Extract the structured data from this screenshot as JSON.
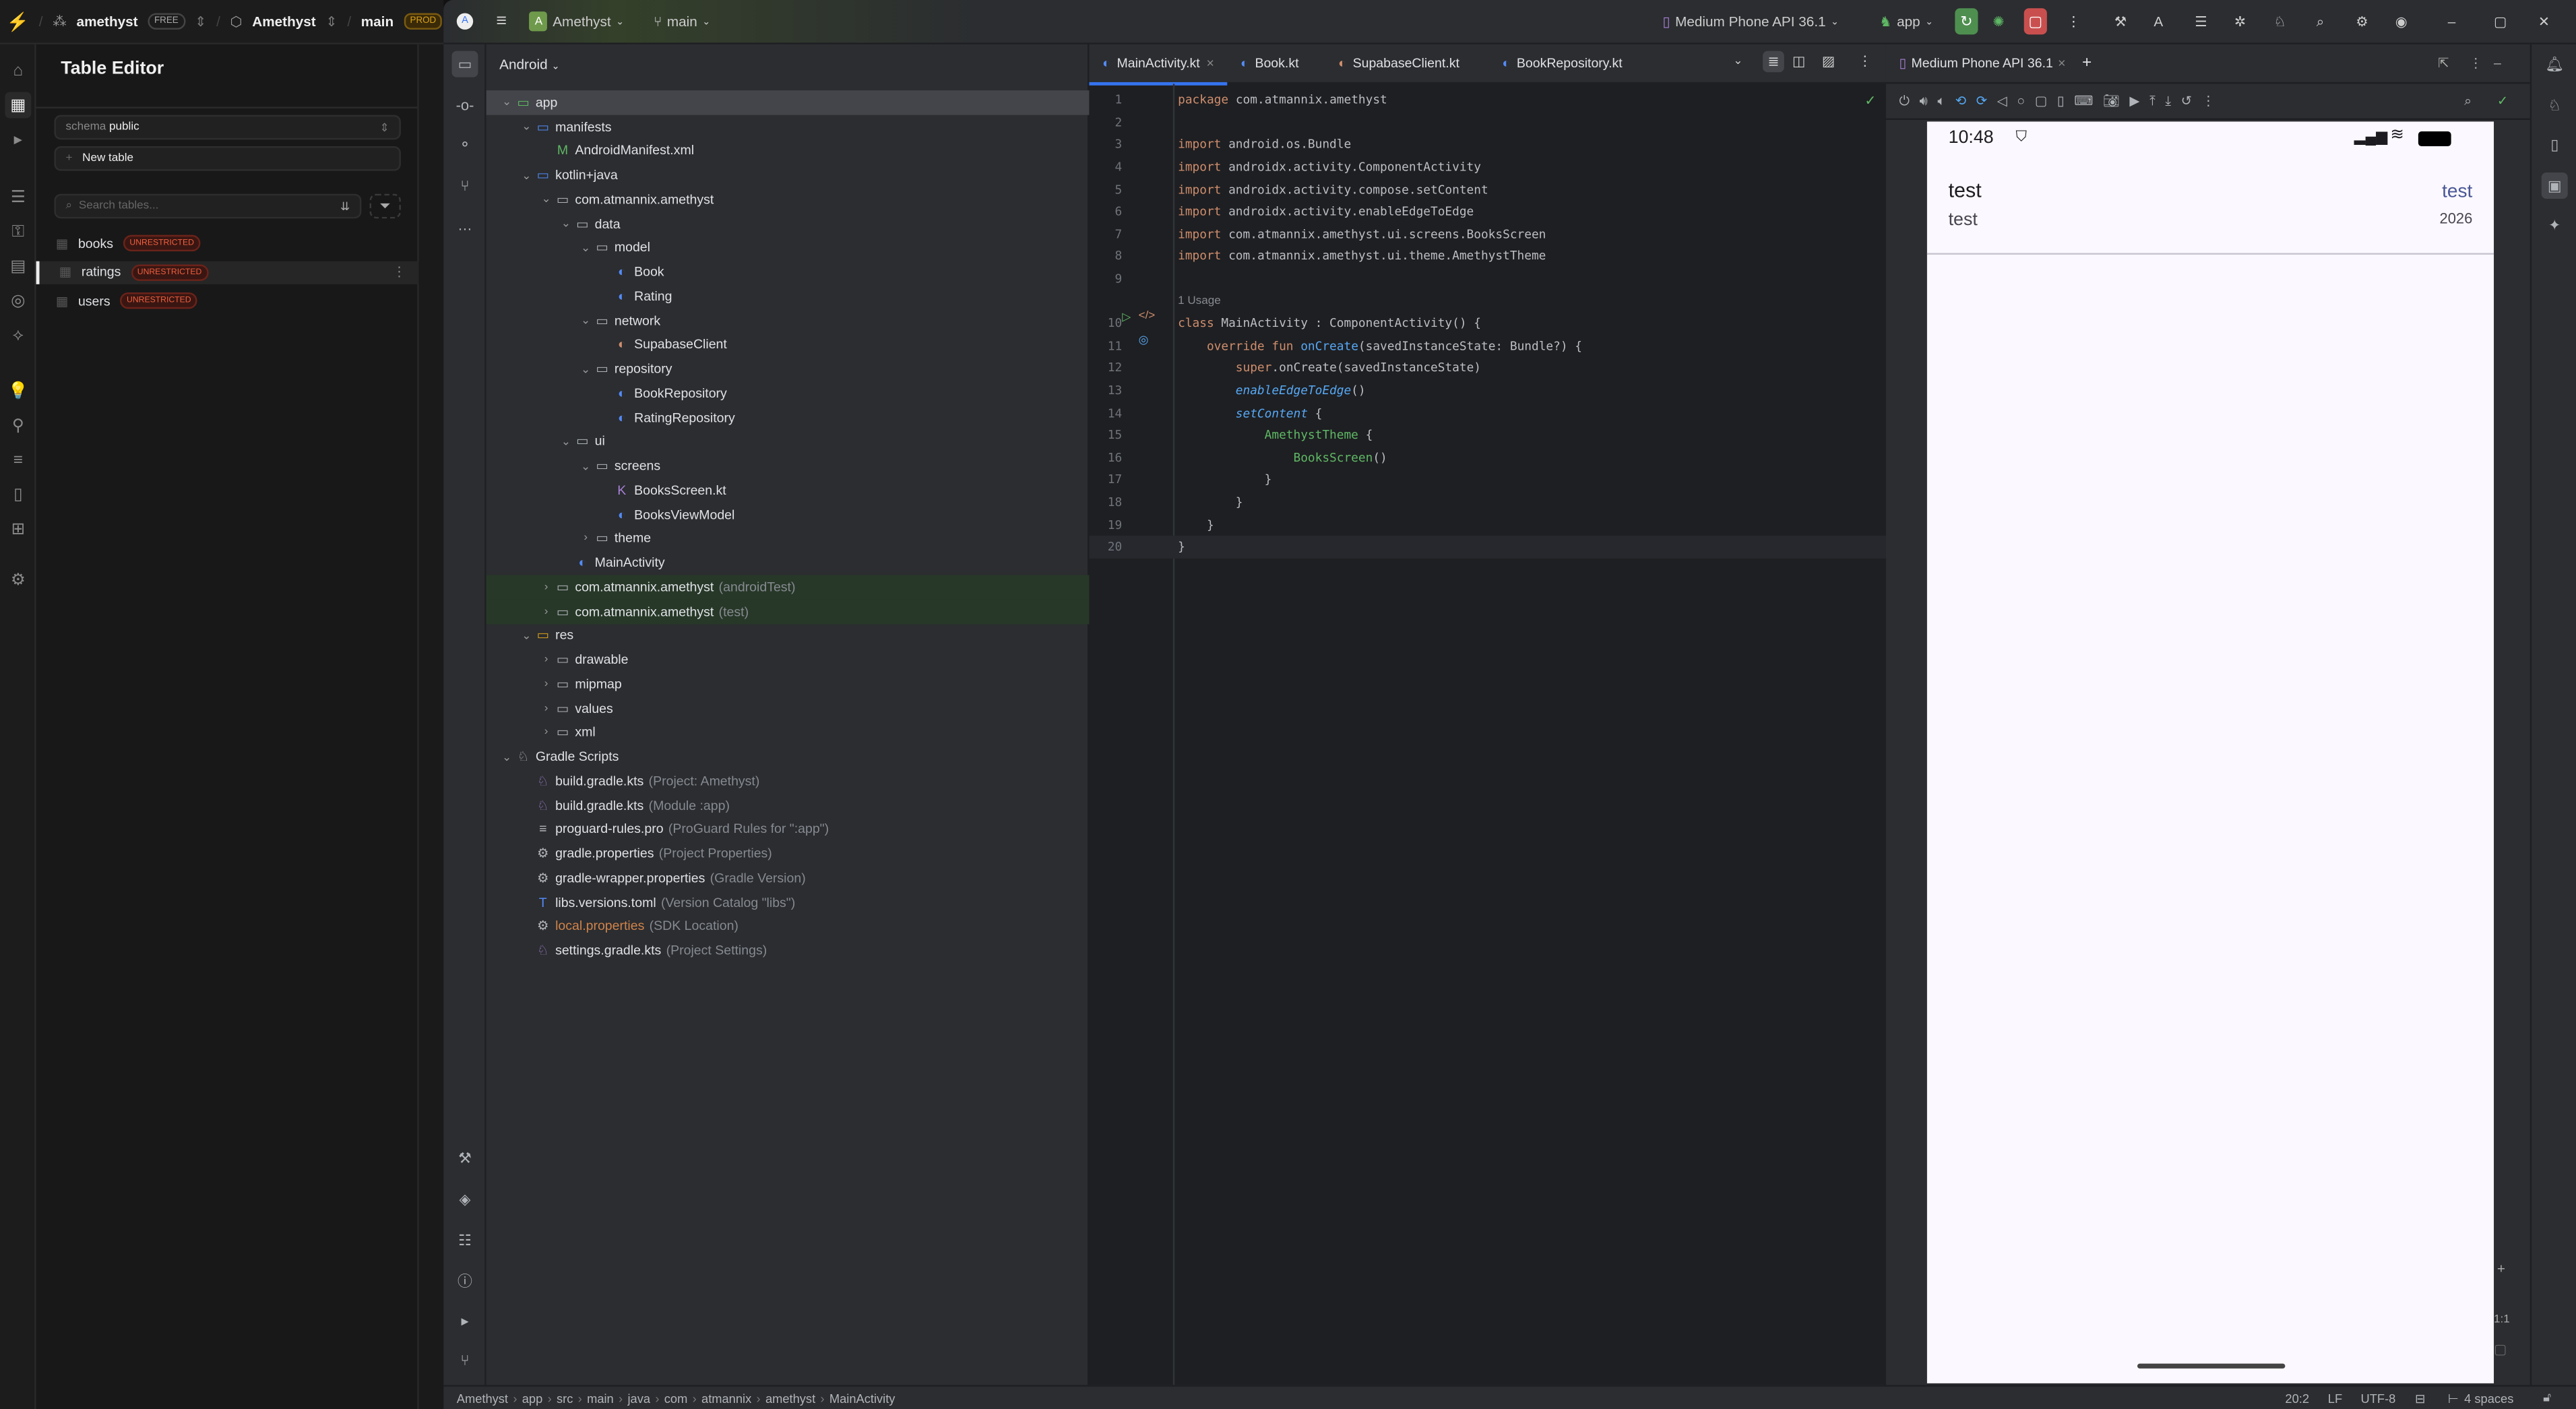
{
  "supabase": {
    "org": "amethyst",
    "plan_badge": "FREE",
    "project": "Amethyst",
    "branch": "main",
    "env_badge": "PROD",
    "panel_title": "Table Editor",
    "schema_label": "schema",
    "schema_value": "public",
    "new_table_label": "New table",
    "search_placeholder": "Search tables...",
    "tables": [
      {
        "name": "books",
        "badge": "UNRESTRICTED",
        "selected": false
      },
      {
        "name": "ratings",
        "badge": "UNRESTRICTED",
        "selected": true
      },
      {
        "name": "users",
        "badge": "UNRESTRICTED",
        "selected": false
      }
    ],
    "brand_color": "#3ecf8e",
    "badge_color": "#f0603f"
  },
  "studio": {
    "project_initial": "A",
    "project_name": "Amethyst",
    "branch": "main",
    "device": "Medium Phone API 36.1",
    "run_config": "app",
    "project_view": "Android",
    "tree": [
      {
        "level": 0,
        "label": "app",
        "icon": "module",
        "expanded": true,
        "selected": true
      },
      {
        "level": 1,
        "label": "manifests",
        "icon": "folder-blue",
        "expanded": true
      },
      {
        "level": 2,
        "label": "AndroidManifest.xml",
        "icon": "manifest"
      },
      {
        "level": 1,
        "label": "kotlin+java",
        "icon": "folder-blue",
        "expanded": true
      },
      {
        "level": 2,
        "label": "com.atmannix.amethyst",
        "icon": "package",
        "expanded": true
      },
      {
        "level": 3,
        "label": "data",
        "icon": "package",
        "expanded": true
      },
      {
        "level": 4,
        "label": "model",
        "icon": "package",
        "expanded": true
      },
      {
        "level": 5,
        "label": "Book",
        "icon": "kotlin-class"
      },
      {
        "level": 5,
        "label": "Rating",
        "icon": "kotlin-class"
      },
      {
        "level": 4,
        "label": "network",
        "icon": "package",
        "expanded": true
      },
      {
        "level": 5,
        "label": "SupabaseClient",
        "icon": "kotlin-object"
      },
      {
        "level": 4,
        "label": "repository",
        "icon": "package",
        "expanded": true
      },
      {
        "level": 5,
        "label": "BookRepository",
        "icon": "kotlin-class"
      },
      {
        "level": 5,
        "label": "RatingRepository",
        "icon": "kotlin-class"
      },
      {
        "level": 3,
        "label": "ui",
        "icon": "package",
        "expanded": true
      },
      {
        "level": 4,
        "label": "screens",
        "icon": "package",
        "expanded": true
      },
      {
        "level": 5,
        "label": "BooksScreen.kt",
        "icon": "kotlin-file"
      },
      {
        "level": 5,
        "label": "BooksViewModel",
        "icon": "kotlin-class"
      },
      {
        "level": 4,
        "label": "theme",
        "icon": "package",
        "expanded": false
      },
      {
        "level": 3,
        "label": "MainActivity",
        "icon": "kotlin-class"
      },
      {
        "level": 2,
        "label": "com.atmannix.amethyst",
        "suffix": "(androidTest)",
        "icon": "package",
        "expanded": false,
        "test": true
      },
      {
        "level": 2,
        "label": "com.atmannix.amethyst",
        "suffix": "(test)",
        "icon": "package",
        "expanded": false,
        "test": true
      },
      {
        "level": 1,
        "label": "res",
        "icon": "res-folder",
        "expanded": true
      },
      {
        "level": 2,
        "label": "drawable",
        "icon": "package",
        "expanded": false
      },
      {
        "level": 2,
        "label": "mipmap",
        "icon": "package",
        "expanded": false
      },
      {
        "level": 2,
        "label": "values",
        "icon": "package",
        "expanded": false
      },
      {
        "level": 2,
        "label": "xml",
        "icon": "package",
        "expanded": false
      },
      {
        "level": 0,
        "label": "Gradle Scripts",
        "icon": "gradle",
        "expanded": true
      },
      {
        "level": 1,
        "label": "build.gradle.kts",
        "suffix": "(Project: Amethyst)",
        "icon": "gradle-kts"
      },
      {
        "level": 1,
        "label": "build.gradle.kts",
        "suffix": "(Module :app)",
        "icon": "gradle-kts"
      },
      {
        "level": 1,
        "label": "proguard-rules.pro",
        "suffix": "(ProGuard Rules for \":app\")",
        "icon": "text-file"
      },
      {
        "level": 1,
        "label": "gradle.properties",
        "suffix": "(Project Properties)",
        "icon": "gear"
      },
      {
        "level": 1,
        "label": "gradle-wrapper.properties",
        "suffix": "(Gradle Version)",
        "icon": "gear"
      },
      {
        "level": 1,
        "label": "libs.versions.toml",
        "suffix": "(Version Catalog \"libs\")",
        "icon": "toml"
      },
      {
        "level": 1,
        "label": "local.properties",
        "suffix": "(SDK Location)",
        "icon": "gear",
        "ignored": true
      },
      {
        "level": 1,
        "label": "settings.gradle.kts",
        "suffix": "(Project Settings)",
        "icon": "gradle-kts"
      }
    ],
    "tabs": [
      {
        "label": "MainActivity.kt",
        "active": true,
        "closable": true
      },
      {
        "label": "Book.kt"
      },
      {
        "label": "SupabaseClient.kt"
      },
      {
        "label": "BookRepository.kt"
      }
    ],
    "usage_hint": "1 Usage",
    "code": [
      [
        [
          "package",
          "k"
        ],
        [
          " com.atmannix.amethyst",
          ""
        ]
      ],
      [],
      [
        [
          "import",
          "k"
        ],
        [
          " android.os.Bundle",
          ""
        ]
      ],
      [
        [
          "import",
          "k"
        ],
        [
          " androidx.activity.ComponentActivity",
          ""
        ]
      ],
      [
        [
          "import",
          "k"
        ],
        [
          " androidx.activity.compose.setContent",
          ""
        ]
      ],
      [
        [
          "import",
          "k"
        ],
        [
          " androidx.activity.enableEdgeToEdge",
          ""
        ]
      ],
      [
        [
          "import",
          "k"
        ],
        [
          " com.atmannix.amethyst.ui.screens.BooksScreen",
          ""
        ]
      ],
      [
        [
          "import",
          "k"
        ],
        [
          " com.atmannix.amethyst.ui.theme.AmethystTheme",
          ""
        ]
      ],
      [],
      [
        [
          "class",
          "k"
        ],
        [
          " MainActivity : ComponentActivity() {",
          ""
        ]
      ],
      [
        [
          "    override fun ",
          "k"
        ],
        [
          "onCreate",
          "f"
        ],
        [
          "(savedInstanceState: Bundle?) {",
          ""
        ]
      ],
      [
        [
          "        super",
          "k"
        ],
        [
          ".onCreate(savedInstanceState)",
          ""
        ]
      ],
      [
        [
          "        enableEdgeToEdge",
          "i"
        ],
        [
          "()",
          ""
        ]
      ],
      [
        [
          "        setContent",
          "i"
        ],
        [
          " {",
          ""
        ]
      ],
      [
        [
          "            AmethystTheme",
          "c"
        ],
        [
          " {",
          ""
        ]
      ],
      [
        [
          "                BooksScreen",
          "c"
        ],
        [
          "()",
          ""
        ]
      ],
      [
        [
          "            }",
          ""
        ]
      ],
      [
        [
          "        }",
          ""
        ]
      ],
      [
        [
          "    }",
          ""
        ]
      ],
      [
        [
          "}",
          ""
        ]
      ]
    ],
    "emulator": {
      "tab_label": "Medium Phone API 36.1",
      "time": "10:48",
      "title": "test",
      "subtitle": "test",
      "right_title": "test",
      "right_sub": "2026",
      "zoom_label": "1:1"
    },
    "breadcrumb": [
      "Amethyst",
      "app",
      "src",
      "main",
      "java",
      "com",
      "atmannix",
      "amethyst",
      "MainActivity"
    ],
    "status": {
      "position": "20:2",
      "line_sep": "LF",
      "encoding": "UTF-8",
      "indent": "4 spaces"
    }
  }
}
